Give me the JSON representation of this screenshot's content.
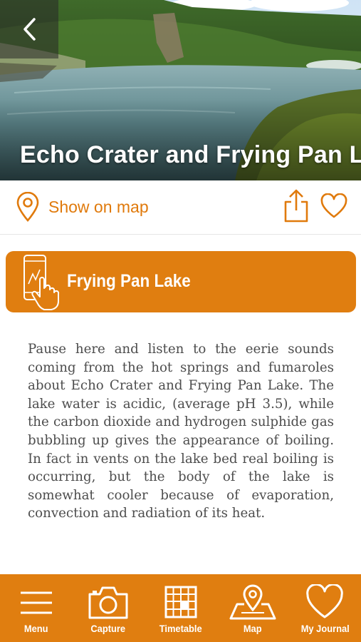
{
  "hero": {
    "title": "Echo Crater and Frying Pan Lake"
  },
  "actions": {
    "map_label": "Show on map",
    "icons": [
      "location-pin-icon",
      "share-icon",
      "heart-icon"
    ]
  },
  "audio": {
    "title": "Frying Pan Lake",
    "icon": "tap-phone-icon"
  },
  "body": {
    "text": "Pause here and listen to the eerie sounds coming from the hot springs and fumaroles about Echo Crater and Frying Pan Lake. The lake water is acidic, (average pH 3.5), while the carbon dioxide and hydrogen sulphide gas bubbling up gives the appearance of boiling. In fact in vents on the lake bed real boiling is occurring, but the body of the lake is somewhat cooler because of evaporation, convection and radiation of its heat."
  },
  "nav": {
    "items": [
      {
        "label": "Menu",
        "icon": "hamburger-menu-icon"
      },
      {
        "label": "Capture",
        "icon": "camera-icon"
      },
      {
        "label": "Timetable",
        "icon": "calendar-grid-icon"
      },
      {
        "label": "Map",
        "icon": "map-pin-icon"
      },
      {
        "label": "My Journal",
        "icon": "heart-icon"
      }
    ]
  },
  "colors": {
    "accent": "#e07e10",
    "text": "#4d4d4d",
    "white": "#ffffff"
  }
}
